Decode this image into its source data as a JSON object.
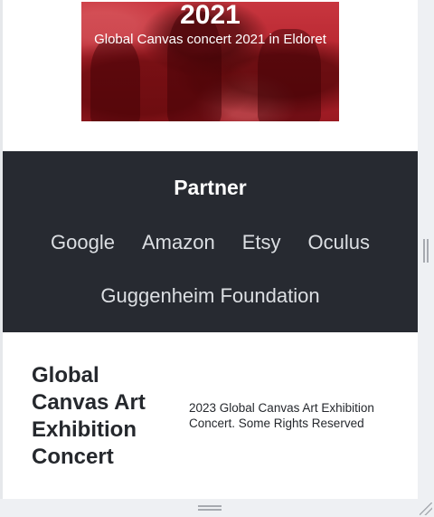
{
  "hero": {
    "year": "2021",
    "caption": "Global Canvas concert 2021 in Eldoret"
  },
  "partner": {
    "title": "Partner",
    "links": [
      "Google",
      "Amazon",
      "Etsy",
      "Oculus",
      "Guggenheim Foundation"
    ]
  },
  "footer": {
    "brand": "Global Canvas Art Exhibition Concert",
    "copyright": "2023 Global Canvas Art Exhibition Concert. Some Rights Reserved"
  },
  "colors": {
    "hero_tint": "#b3222c",
    "partner_bg": "#272a31",
    "text_dark": "#25282d"
  }
}
